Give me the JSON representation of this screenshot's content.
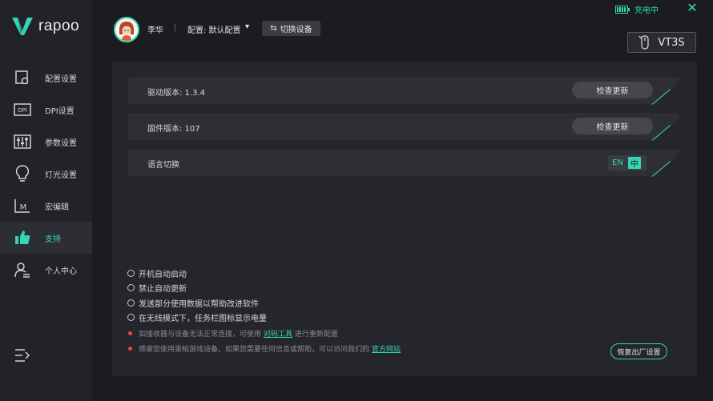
{
  "app": {
    "brand": "rapoo"
  },
  "titlebar": {
    "charge_status": "充电中",
    "close_icon": "close-icon"
  },
  "user": {
    "name": "李华",
    "separator": "|",
    "profile_label": "配置: 默认配置",
    "switch_device_label": "切换设备"
  },
  "device": {
    "model": "VT3S"
  },
  "sidebar": {
    "items": [
      {
        "label": "配置设置",
        "icon": "config-icon",
        "active": false
      },
      {
        "label": "DPI设置",
        "icon": "dpi-icon",
        "active": false
      },
      {
        "label": "参数设置",
        "icon": "sliders-icon",
        "active": false
      },
      {
        "label": "灯光设置",
        "icon": "bulb-icon",
        "active": false
      },
      {
        "label": "宏编辑",
        "icon": "macro-icon",
        "active": false
      },
      {
        "label": "支持",
        "icon": "thumbs-up-icon",
        "active": true
      },
      {
        "label": "个人中心",
        "icon": "user-icon",
        "active": false
      }
    ]
  },
  "main": {
    "driver_label": "驱动版本: 1.3.4",
    "driver_button": "检查更新",
    "firmware_label": "固件版本: 107",
    "firmware_button": "检查更新",
    "language_label": "语言切换",
    "language_en": "EN",
    "language_zh": "中",
    "language_selected": "中",
    "options": [
      "开机自动启动",
      "禁止自动更新",
      "发送部分使用数据以帮助改进软件",
      "在无线模式下，任务栏图标显示电量"
    ],
    "note1_before": "如接收器与设备无法正常连接，可使用",
    "note1_link": "对码工具",
    "note1_after": "进行重新配置",
    "note2_before": "感谢您使用雷柏游戏设备。如果您需要任何信息或帮助，可以访问我们的",
    "note2_link": "官方网站",
    "reset_button": "恢复出厂设置"
  },
  "colors": {
    "accent": "#33d6b6",
    "background": "#1b1c20",
    "panel": "#25262b",
    "row": "#2e2f35",
    "alert": "#e54848"
  }
}
